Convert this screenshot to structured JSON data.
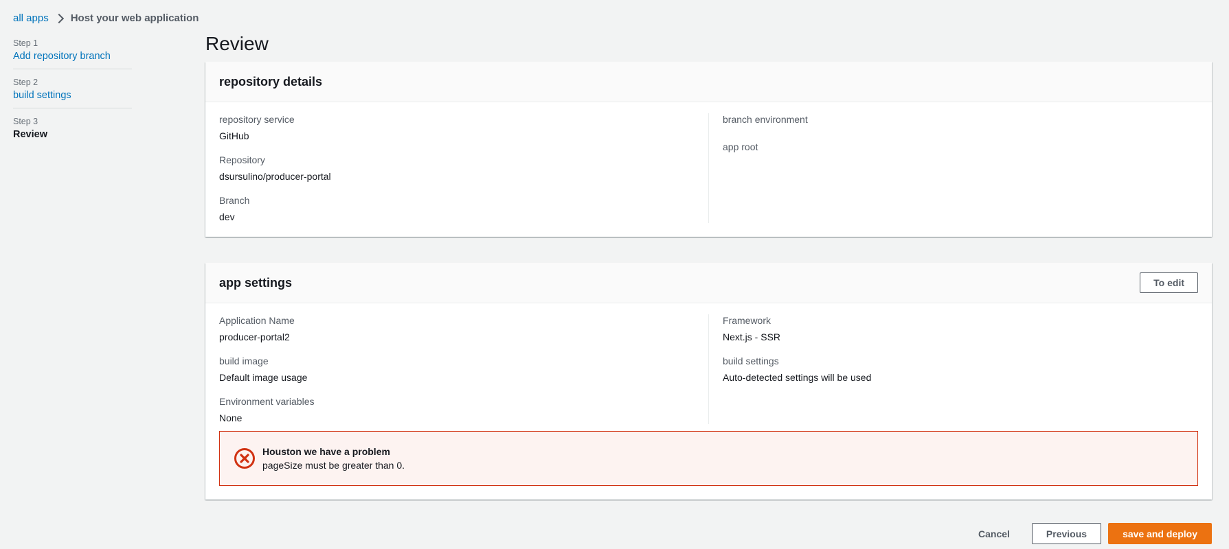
{
  "breadcrumb": {
    "root": "all apps",
    "current": "Host your web application"
  },
  "steps": [
    {
      "num": "Step 1",
      "label": "Add repository branch"
    },
    {
      "num": "Step 2",
      "label": "build settings"
    },
    {
      "num": "Step 3",
      "label": "Review"
    }
  ],
  "page": {
    "title": "Review"
  },
  "repository_panel": {
    "title": "repository details",
    "service_label": "repository service",
    "service_value": "GitHub",
    "repo_label": "Repository",
    "repo_value": "dsursulino/producer-portal",
    "branch_label": "Branch",
    "branch_value": "dev",
    "env_label": "branch environment",
    "env_value": "",
    "root_label": "app root",
    "root_value": ""
  },
  "app_panel": {
    "title": "app settings",
    "edit_label": "To edit",
    "name_label": "Application Name",
    "name_value": "producer-portal2",
    "image_label": "build image",
    "image_value": "Default image usage",
    "env_vars_label": "Environment variables",
    "env_vars_value": "None",
    "framework_label": "Framework",
    "framework_value": "Next.js - SSR",
    "build_settings_label": "build settings",
    "build_settings_value": "Auto-detected settings will be used"
  },
  "alert": {
    "title": "Houston we have a problem",
    "message": "pageSize must be greater than 0."
  },
  "actions": {
    "cancel": "Cancel",
    "previous": "Previous",
    "deploy": "save and deploy"
  },
  "colors": {
    "link": "#0073bb",
    "primary": "#ec7211",
    "error": "#d13212",
    "background": "#f2f3f3"
  }
}
